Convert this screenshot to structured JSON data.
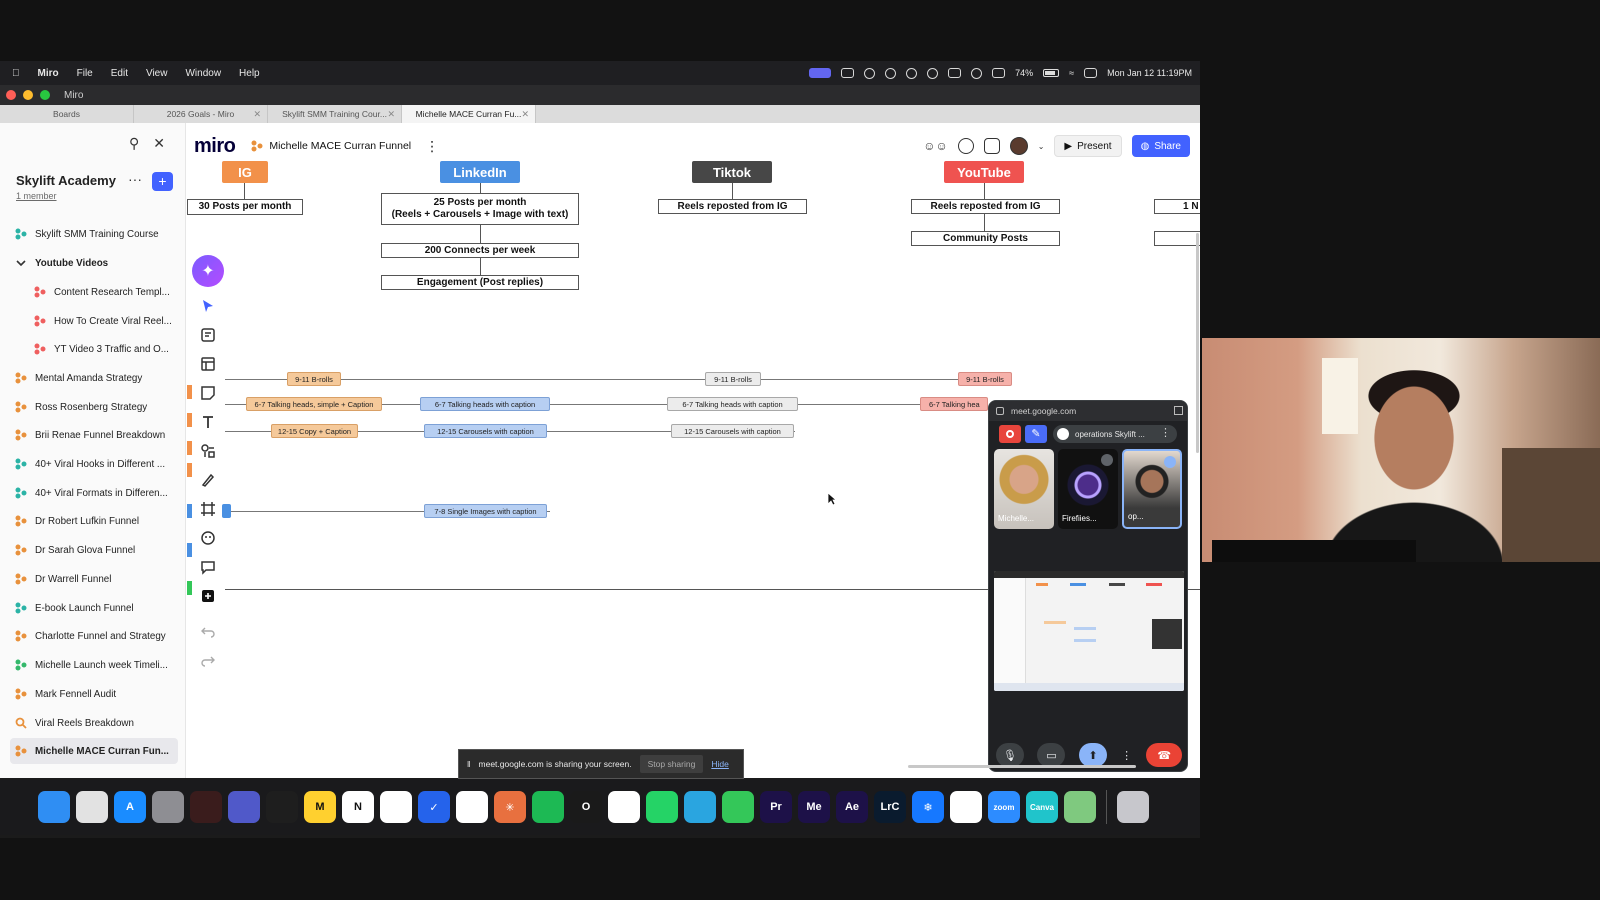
{
  "menubar": {
    "app_name": "Miro",
    "items": [
      "File",
      "Edit",
      "View",
      "Window",
      "Help"
    ],
    "battery": "74%",
    "clock": "Mon Jan 12  11:19PM"
  },
  "window": {
    "title": "Miro"
  },
  "tabs": [
    {
      "label": "Boards"
    },
    {
      "label": "2026 Goals - Miro"
    },
    {
      "label": "Skylift SMM Training Cour..."
    },
    {
      "label": "Michelle MACE Curran Fu..."
    }
  ],
  "board": {
    "logo": "miro",
    "title": "Michelle MACE Curran Funnel",
    "present_label": "Present",
    "share_label": "Share"
  },
  "sidebar": {
    "workspace": "Skylift Academy",
    "members": "1 member",
    "items": [
      {
        "label": "Skylift SMM Training Course",
        "icon": "board-icon-teal"
      },
      {
        "label": "Youtube Videos",
        "icon": "chevron-down-icon"
      },
      {
        "label": "Content Research Templ...",
        "icon": "board-icon-red"
      },
      {
        "label": "How To Create Viral Reel...",
        "icon": "board-icon-red"
      },
      {
        "label": "YT Video 3 Traffic and O...",
        "icon": "board-icon-red"
      },
      {
        "label": "Mental Amanda Strategy",
        "icon": "board-icon-orange"
      },
      {
        "label": "Ross Rosenberg Strategy",
        "icon": "board-icon-orange"
      },
      {
        "label": "Brii Renae Funnel Breakdown",
        "icon": "board-icon-orange"
      },
      {
        "label": "40+ Viral Hooks in Different ...",
        "icon": "board-icon-teal"
      },
      {
        "label": "40+ Viral Formats in Differen...",
        "icon": "board-icon-teal"
      },
      {
        "label": "Dr Robert Lufkin Funnel",
        "icon": "board-icon-orange"
      },
      {
        "label": "Dr Sarah Glova Funnel",
        "icon": "board-icon-orange"
      },
      {
        "label": "Dr Warrell Funnel",
        "icon": "board-icon-orange"
      },
      {
        "label": "E-book Launch Funnel",
        "icon": "board-icon-teal"
      },
      {
        "label": "Charlotte Funnel and Strategy",
        "icon": "board-icon-orange"
      },
      {
        "label": "Michelle Launch week Timeli...",
        "icon": "board-icon-green"
      },
      {
        "label": "Mark Fennell Audit",
        "icon": "board-icon-orange"
      },
      {
        "label": "Viral Reels Breakdown",
        "icon": "search-board-icon"
      },
      {
        "label": "Michelle MACE Curran Fun...",
        "icon": "board-icon-orange"
      }
    ]
  },
  "canvas": {
    "platforms": [
      {
        "label": "IG",
        "color": "#f2914a"
      },
      {
        "label": "LinkedIn",
        "color": "#4a90e2"
      },
      {
        "label": "Tiktok",
        "color": "#474747"
      },
      {
        "label": "YouTube",
        "color": "#ef5350"
      }
    ],
    "ig_boxes": [
      "30 Posts per month"
    ],
    "linkedin_boxes": [
      "25 Posts per month",
      "(Reels + Carousels + Image with text)",
      "200 Connects per week",
      "Engagement (Post replies)"
    ],
    "tiktok_boxes": [
      "Reels reposted from IG"
    ],
    "youtube_boxes": [
      "Reels reposted from IG",
      "Community Posts"
    ],
    "right_box": "1 N",
    "tags": {
      "ig_brolls": "9-11 B-rolls",
      "ig_talking": "6-7 Talking heads, simple + Caption",
      "ig_copy": "12-15 Copy + Caption",
      "li_talking": "6-7 Talking heads with caption",
      "li_carousels": "12-15 Carousels with caption",
      "li_images": "7-8 Single Images with caption",
      "tt_brolls": "9-11 B-rolls",
      "tt_talking": "6-7 Talking heads with caption",
      "tt_carousels": "12-15 Carousels with caption",
      "yt_brolls": "9-11 B-rolls",
      "yt_talking": "6-7 Talking hea"
    }
  },
  "meet": {
    "url": "meet.google.com",
    "meeting_name": "operations Skylift ...",
    "participants": [
      {
        "name": "Michelle..."
      },
      {
        "name": "Firefiies..."
      },
      {
        "name": "op..."
      }
    ]
  },
  "sharebar": {
    "message": "meet.google.com is sharing your screen.",
    "stop_label": "Stop sharing",
    "hide_label": "Hide"
  },
  "dock": [
    {
      "name": "finder",
      "color": "#2f8ef3",
      "label": ""
    },
    {
      "name": "launchpad",
      "color": "#e2e2e2",
      "label": ""
    },
    {
      "name": "app-store",
      "color": "#1a8cff",
      "label": "A"
    },
    {
      "name": "settings",
      "color": "#8e8e93",
      "label": ""
    },
    {
      "name": "screen",
      "color": "#3a1c1c",
      "label": ""
    },
    {
      "name": "teams",
      "color": "#5059c9",
      "label": ""
    },
    {
      "name": "figma",
      "color": "#1e1e1e",
      "label": ""
    },
    {
      "name": "miro",
      "color": "#ffd02f",
      "label": "M"
    },
    {
      "name": "notion",
      "color": "#ffffff",
      "label": "N"
    },
    {
      "name": "slack",
      "color": "#ffffff",
      "label": ""
    },
    {
      "name": "tasks",
      "color": "#2563eb",
      "label": "✓"
    },
    {
      "name": "chatgpt",
      "color": "#ffffff",
      "label": ""
    },
    {
      "name": "claude",
      "color": "#e8703f",
      "label": "✳"
    },
    {
      "name": "spotify",
      "color": "#1db954",
      "label": ""
    },
    {
      "name": "opera",
      "color": "#1a1a1a",
      "label": "O"
    },
    {
      "name": "chrome",
      "color": "#ffffff",
      "label": ""
    },
    {
      "name": "whatsapp",
      "color": "#25d366",
      "label": ""
    },
    {
      "name": "telegram",
      "color": "#2aa5e0",
      "label": ""
    },
    {
      "name": "facetime",
      "color": "#34c759",
      "label": ""
    },
    {
      "name": "premiere",
      "color": "#1d1148",
      "label": "Pr"
    },
    {
      "name": "media-encoder",
      "color": "#1d1148",
      "label": "Me"
    },
    {
      "name": "after-effects",
      "color": "#1d1148",
      "label": "Ae"
    },
    {
      "name": "lightroom",
      "color": "#0a1b2e",
      "label": "LrC"
    },
    {
      "name": "snowflake",
      "color": "#1678ff",
      "label": "❄"
    },
    {
      "name": "arc",
      "color": "#ffffff",
      "label": ""
    },
    {
      "name": "zoom",
      "color": "#2d8cff",
      "label": "zoom"
    },
    {
      "name": "canva",
      "color": "#20c4cb",
      "label": "Canva"
    },
    {
      "name": "maps",
      "color": "#7fc97f",
      "label": ""
    },
    {
      "name": "trash",
      "color": "#c7c7cc",
      "label": ""
    }
  ]
}
